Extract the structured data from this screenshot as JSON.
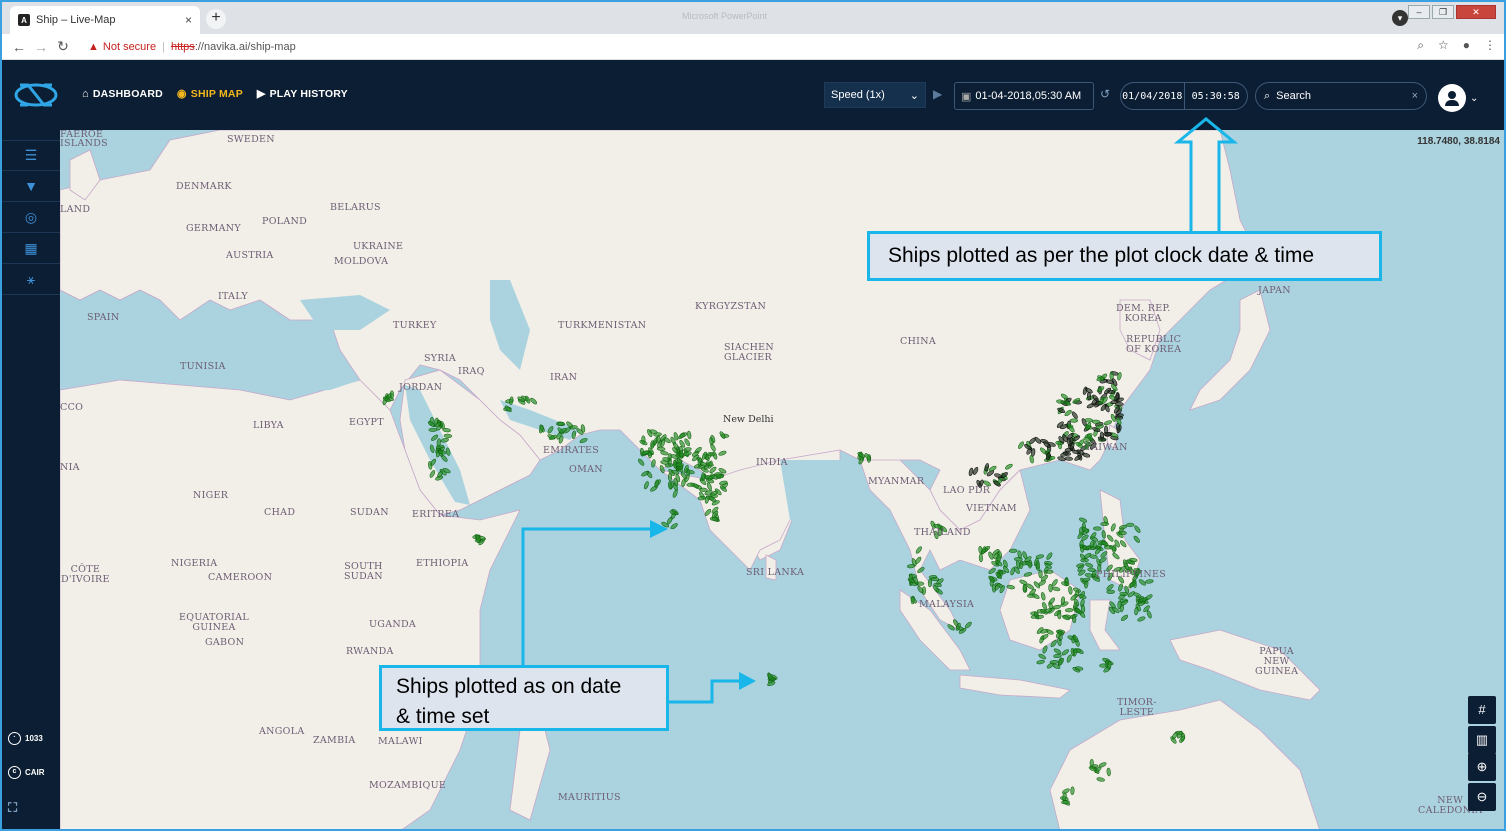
{
  "browser": {
    "tab_title": "Ship – Live-Map",
    "tab_favicon": "A",
    "tab_close": "×",
    "new_tab": "+",
    "window_title": "Microsoft PowerPoint",
    "security_label": "Not secure",
    "url_scheme": "https",
    "url_rest": "://navika.ai/ship-map"
  },
  "app": {
    "nav": [
      {
        "label": "DASHBOARD",
        "icon": "home-icon"
      },
      {
        "label": "SHIP MAP",
        "icon": "target-icon"
      },
      {
        "label": "PLAY HISTORY",
        "icon": "play-icon"
      }
    ],
    "speed_select": "Speed (1x)",
    "datetime_value": "01-04-2018,05:30 AM",
    "plot_clock_date": "01/04/2018",
    "plot_clock_time": "05:30:58",
    "search_placeholder": "Search",
    "search_clear": "×"
  },
  "sidebar": {
    "count": "1033",
    "brand": "CAIR"
  },
  "map": {
    "cursor_coords": "118.7480, 38.8184",
    "labels": {
      "faeroe": "FAEROE\nISLANDS",
      "sweden": "SWEDEN",
      "denmark": "DENMARK",
      "land": "LAND",
      "belarus": "BELARUS",
      "poland": "POLAND",
      "germany": "GERMANY",
      "ukraine": "UKRAINE",
      "moldova": "MOLDOVA",
      "austria": "AUSTRIA",
      "italy": "ITALY",
      "spain": "SPAIN",
      "turkey": "TURKEY",
      "kyrgyzstan": "KYRGYZSTAN",
      "turkmenistan": "TURKMENISTAN",
      "tunisia": "TUNISIA",
      "syria": "SYRIA",
      "iraq": "IRAQ",
      "jordan": "JORDAN",
      "iran": "IRAN",
      "siachen": "SIACHEN\nGLACIER",
      "china": "CHINA",
      "dem_rep_korea": "DEM. REP.\nKOREA",
      "rep_korea": "REPUBLIC\nOF KOREA",
      "japan": "JAPAN",
      "morocco": "CCO",
      "libya": "LIBYA",
      "egypt": "EGYPT",
      "uae": "EMIRATES",
      "oman": "OMAN",
      "india": "INDIA",
      "new_delhi": "New Delhi",
      "myanmar": "MYANMAR",
      "lao": "LAO PDR",
      "vietnam": "VIETNAM",
      "taiwan": "TAIWAN",
      "algeria": "NIA",
      "niger": "NIGER",
      "chad": "CHAD",
      "sudan": "SUDAN",
      "eritrea": "ERITREA",
      "thailand": "THAILAND",
      "philippines": "PHILIPPINES",
      "ethiopia": "ETHIOPIA",
      "nigeria": "NIGERIA",
      "cote": "CÔTE\nD'IVOIRE",
      "cameroon": "CAMEROON",
      "south_sudan": "SOUTH\nSUDAN",
      "sri_lanka": "SRI LANKA",
      "malaysia": "MALAYSIA",
      "eq_guinea": "EQUATORIAL\nGUINEA",
      "gabon": "GABON",
      "uganda": "UGANDA",
      "rwanda": "RWANDA",
      "papua": "PAPUA\nNEW\nGUINEA",
      "timor": "TIMOR-\nLESTE",
      "angola": "ANGOLA",
      "zambia": "ZAMBIA",
      "malawi": "MALAWI",
      "mozambique": "MOZAMBIQUE",
      "mauritius": "MAURITIUS",
      "new_caledonia": "NEW\nCALEDONIA"
    },
    "controls": [
      "grid-icon",
      "map-layers-icon",
      "zoom-in-icon",
      "zoom-out-icon"
    ],
    "colors": {
      "ocean": "#abd3df",
      "land": "#f2efe9",
      "ship": "#1e8a1e",
      "ship_dark": "#1a2a1a"
    }
  },
  "annotations": {
    "clock_callout": "Ships plotted  as per the plot clock date & time",
    "date_callout_line1": "Ships plotted as on date",
    "date_callout_line2": "& time set",
    "color": "#19b6ea"
  }
}
